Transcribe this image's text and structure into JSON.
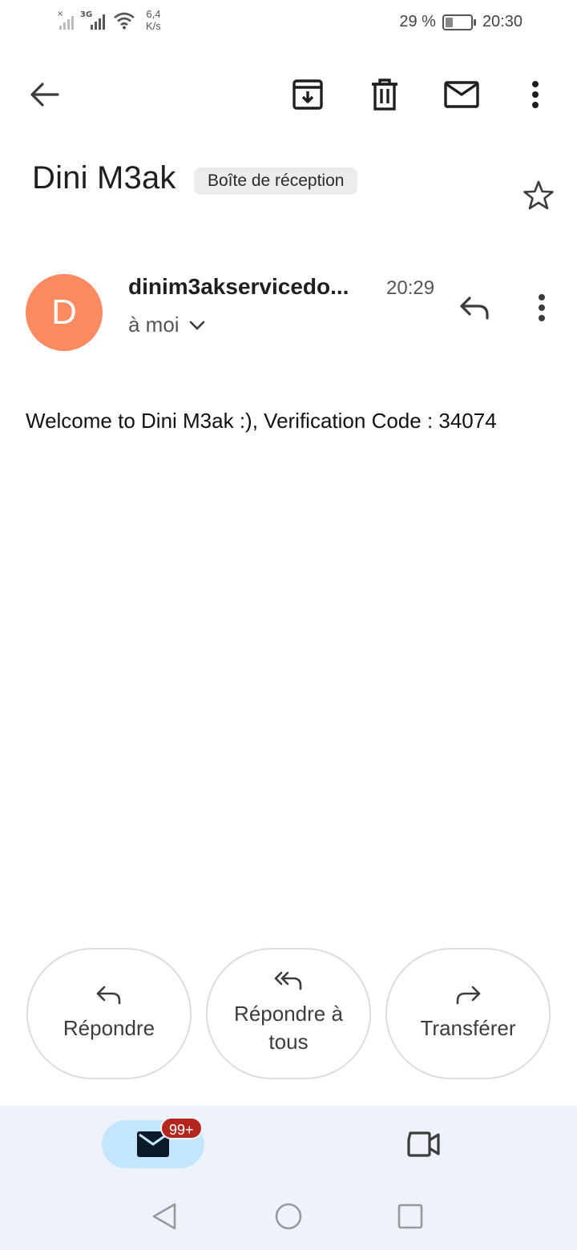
{
  "status_bar": {
    "network_speed_value": "6,4",
    "network_speed_unit": "K/s",
    "signal_type": "3G",
    "battery_percent_text": "29 %",
    "battery_level": 0.29,
    "time": "20:30"
  },
  "toolbar": {
    "back_icon": "arrow-back-icon",
    "archive_icon": "archive-icon",
    "delete_icon": "trash-icon",
    "mark_unread_icon": "mail-icon",
    "more_icon": "more-vert-icon"
  },
  "email": {
    "subject": "Dini M3ak",
    "label": "Boîte de réception",
    "sender_initial": "D",
    "sender": "dinim3akservicedo...",
    "time": "20:29",
    "recipient": "à moi",
    "body": "Welcome to Dini M3ak :), Verification Code : 34074",
    "avatar_color": "#fd8a60"
  },
  "actions": {
    "reply": "Répondre",
    "reply_all": "Répondre à tous",
    "forward": "Transférer"
  },
  "bottom_nav": {
    "mail_badge": "99+",
    "mail_icon": "mail-icon",
    "meet_icon": "video-icon"
  }
}
